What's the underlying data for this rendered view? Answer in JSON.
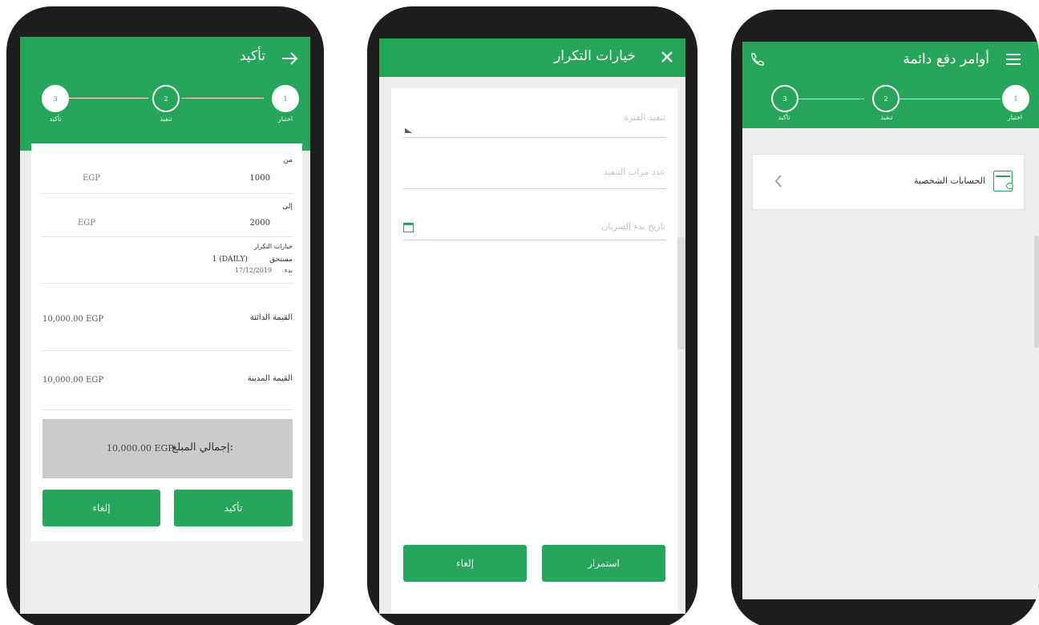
{
  "colors": {
    "accent": "#27a55b",
    "phone_frame": "#1d1d1d",
    "screen_bg": "#eeeeee",
    "total_box": "#cacaca"
  },
  "screen_confirm": {
    "title": "تأكيد",
    "back_icon": "arrow-right-icon",
    "steps": [
      {
        "number": "1",
        "label": "اختيار"
      },
      {
        "number": "2",
        "label": "تنفيذ"
      },
      {
        "number": "3",
        "label": "تأكيد"
      }
    ],
    "from_label": "من",
    "from_amount": "1000",
    "from_currency": "EGP",
    "to_label": "إلى",
    "to_amount": "2000",
    "to_currency": "EGP",
    "repeat_label": "خيارات التكرار",
    "repeat_due_label": "مستحق",
    "repeat_due_value": "1 (DAILY)",
    "repeat_start_label": "بدء",
    "repeat_start_value": "17/12/2019",
    "credit_label": "القيمة الدائنة",
    "credit_value": "10,000.00 EGP",
    "debit_label": "القيمة المدينة",
    "debit_value": "10,000.00 EGP",
    "total_label": "إجمالي المبلغ:",
    "total_value": "10,000.00 EGP",
    "confirm_button": "تأكيد",
    "cancel_button": "إلغاء"
  },
  "screen_repeat": {
    "title": "خيارات التكرار",
    "close_icon": "close-icon",
    "fields": {
      "period_placeholder": "تنفيذ الفترة",
      "count_placeholder": "عدد مرات التنفيذ",
      "start_date_placeholder": "تاريخ بدء السريان"
    },
    "continue_button": "استمرار",
    "cancel_button": "إلغاء"
  },
  "screen_orders": {
    "title": "أوامر دفع دائمة",
    "menu_icon": "hamburger-menu-icon",
    "phone_icon": "phone-icon",
    "steps": [
      {
        "number": "1",
        "label": "اختيار"
      },
      {
        "number": "2",
        "label": "تنفيذ"
      },
      {
        "number": "3",
        "label": "تأكيد"
      }
    ],
    "accounts_item": "الحسابات الشخصية",
    "accounts_icon": "wallet-icon",
    "chevron_icon": "chevron-left-icon"
  }
}
